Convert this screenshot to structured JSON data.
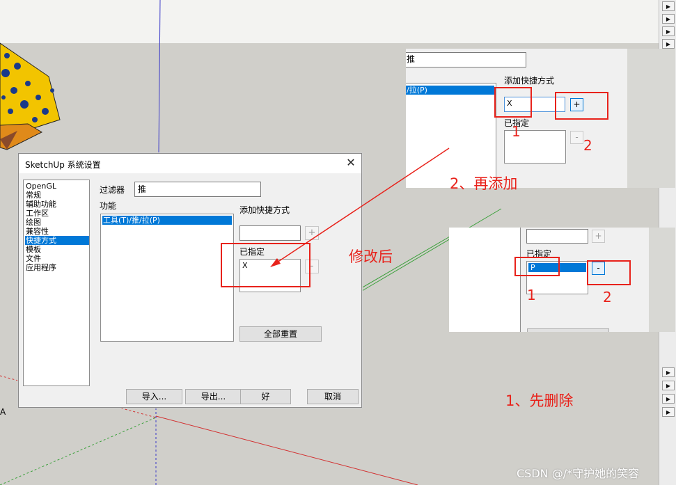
{
  "dialog": {
    "title": "SketchUp 系统设置",
    "close_glyph": "✕",
    "categories": [
      {
        "label": "OpenGL",
        "selected": false
      },
      {
        "label": "常规",
        "selected": false
      },
      {
        "label": "辅助功能",
        "selected": false
      },
      {
        "label": "工作区",
        "selected": false
      },
      {
        "label": "绘图",
        "selected": false
      },
      {
        "label": "兼容性",
        "selected": false
      },
      {
        "label": "快捷方式",
        "selected": true
      },
      {
        "label": "模板",
        "selected": false
      },
      {
        "label": "文件",
        "selected": false
      },
      {
        "label": "应用程序",
        "selected": false
      }
    ],
    "filter_label": "过滤器",
    "filter_value": "推",
    "function_label": "功能",
    "function_item": "工具(T)/推/拉(P)",
    "add_shortcut_label": "添加快捷方式",
    "add_button": "+",
    "assigned_label": "已指定",
    "assigned_value": "X",
    "remove_button": "-",
    "reset_all_button": "全部重置",
    "import_button": "导入...",
    "export_button": "导出...",
    "ok_button": "好",
    "cancel_button": "取消"
  },
  "crop_add": {
    "filter_value": "推",
    "function_item": "/拉(P)",
    "add_shortcut_label": "添加快捷方式",
    "input_value": "X",
    "add_button": "+",
    "assigned_label": "已指定",
    "remove_button": "-"
  },
  "crop_remove": {
    "add_button": "+",
    "assigned_label": "已指定",
    "assigned_value": "P",
    "remove_button": "-"
  },
  "annotations": {
    "after_edit": "修改后",
    "step_two": "2、再添加",
    "step_one": "1、先删除",
    "crop_add_mark_1": "1",
    "crop_add_mark_2": "2",
    "crop_remove_mark_1": "1",
    "crop_remove_mark_2": "2"
  },
  "side_tray": {
    "arrow_glyph": "▶"
  },
  "watermark": "CSDN @/*守护她的笑容",
  "colors": {
    "annotation_red": "#e8221b",
    "selection_blue": "#0078d7",
    "viewport_gray": "#d0cfca"
  }
}
